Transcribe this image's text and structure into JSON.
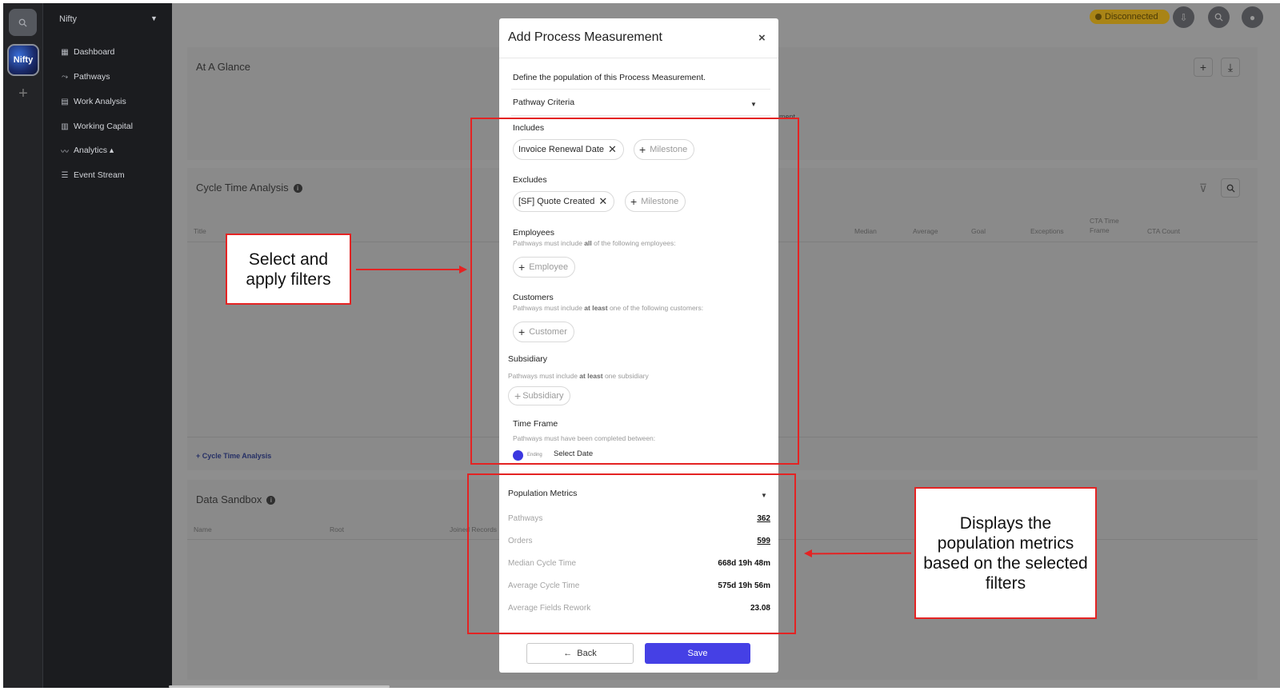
{
  "workspace": "Nifty",
  "rail": {
    "logo_text": "Nifty",
    "add_symbol": "+"
  },
  "nav": {
    "items": [
      {
        "label": "Dashboard",
        "icon": "dashboard-icon",
        "glyph": "▦"
      },
      {
        "label": "Pathways",
        "icon": "pathways-icon",
        "glyph": "⤳"
      },
      {
        "label": "Work Analysis",
        "icon": "work-analysis-icon",
        "glyph": "▤"
      },
      {
        "label": "Working Capital",
        "icon": "working-capital-icon",
        "glyph": "▥"
      },
      {
        "label": "Analytics ▴",
        "icon": "analytics-icon",
        "glyph": "〰"
      },
      {
        "label": "Event Stream",
        "icon": "event-stream-icon",
        "glyph": "☰"
      }
    ]
  },
  "topbar": {
    "status": "Disconnected",
    "status_color": "#a98416"
  },
  "background": {
    "at_a_glance": {
      "title": "At A Glance",
      "partial_text": "ment"
    },
    "cycle_time": {
      "title": "Cycle Time Analysis",
      "columns": [
        "Title",
        "Median",
        "Average",
        "Goal",
        "Exceptions",
        "CTA Time Frame",
        "CTA Count"
      ],
      "link": "+ Cycle Time Analysis"
    },
    "data_sandbox": {
      "title": "Data Sandbox",
      "columns": [
        "Name",
        "Root",
        "Joined Records"
      ]
    }
  },
  "modal": {
    "title": "Add Process Measurement",
    "close": "×",
    "description": "Define the population of this Process Measurement.",
    "criteria_label": "Pathway Criteria",
    "includes": {
      "label": "Includes",
      "chip": "Invoice Renewal Date",
      "add": "Milestone"
    },
    "excludes": {
      "label": "Excludes",
      "chip": "[SF] Quote Created",
      "add": "Milestone"
    },
    "employees": {
      "label": "Employees",
      "sub_pre": "Pathways must include ",
      "sub_bold": "all",
      "sub_post": " of the following employees:",
      "add": "Employee"
    },
    "customers": {
      "label": "Customers",
      "sub_pre": "Pathways must include ",
      "sub_bold": "at least",
      "sub_post": " one of the following customers:",
      "add": "Customer"
    },
    "subsidiary": {
      "label": "Subsidiary",
      "sub_pre": "Pathways must include ",
      "sub_bold": "at least",
      "sub_post": " one subsidiary",
      "add": "Subsidiary"
    },
    "time_frame": {
      "label": "Time Frame",
      "sub": "Pathways must have been completed between:",
      "toggle_label": "Ending",
      "date": "Select Date"
    },
    "population_metrics": {
      "title": "Population Metrics",
      "rows": [
        {
          "label": "Pathways",
          "value": "362"
        },
        {
          "label": "Orders",
          "value": "599"
        },
        {
          "label": "Median Cycle Time",
          "value": "668d 19h 48m"
        },
        {
          "label": "Average Cycle Time",
          "value": "575d 19h 56m"
        },
        {
          "label": "Average Fields Rework",
          "value": "23.08"
        }
      ]
    },
    "back": "Back",
    "save": "Save",
    "accent": "#4540e5"
  },
  "annotations": {
    "left": "Select and apply filters",
    "right": "Displays the population metrics based on the selected filters",
    "color": "#e42323"
  }
}
